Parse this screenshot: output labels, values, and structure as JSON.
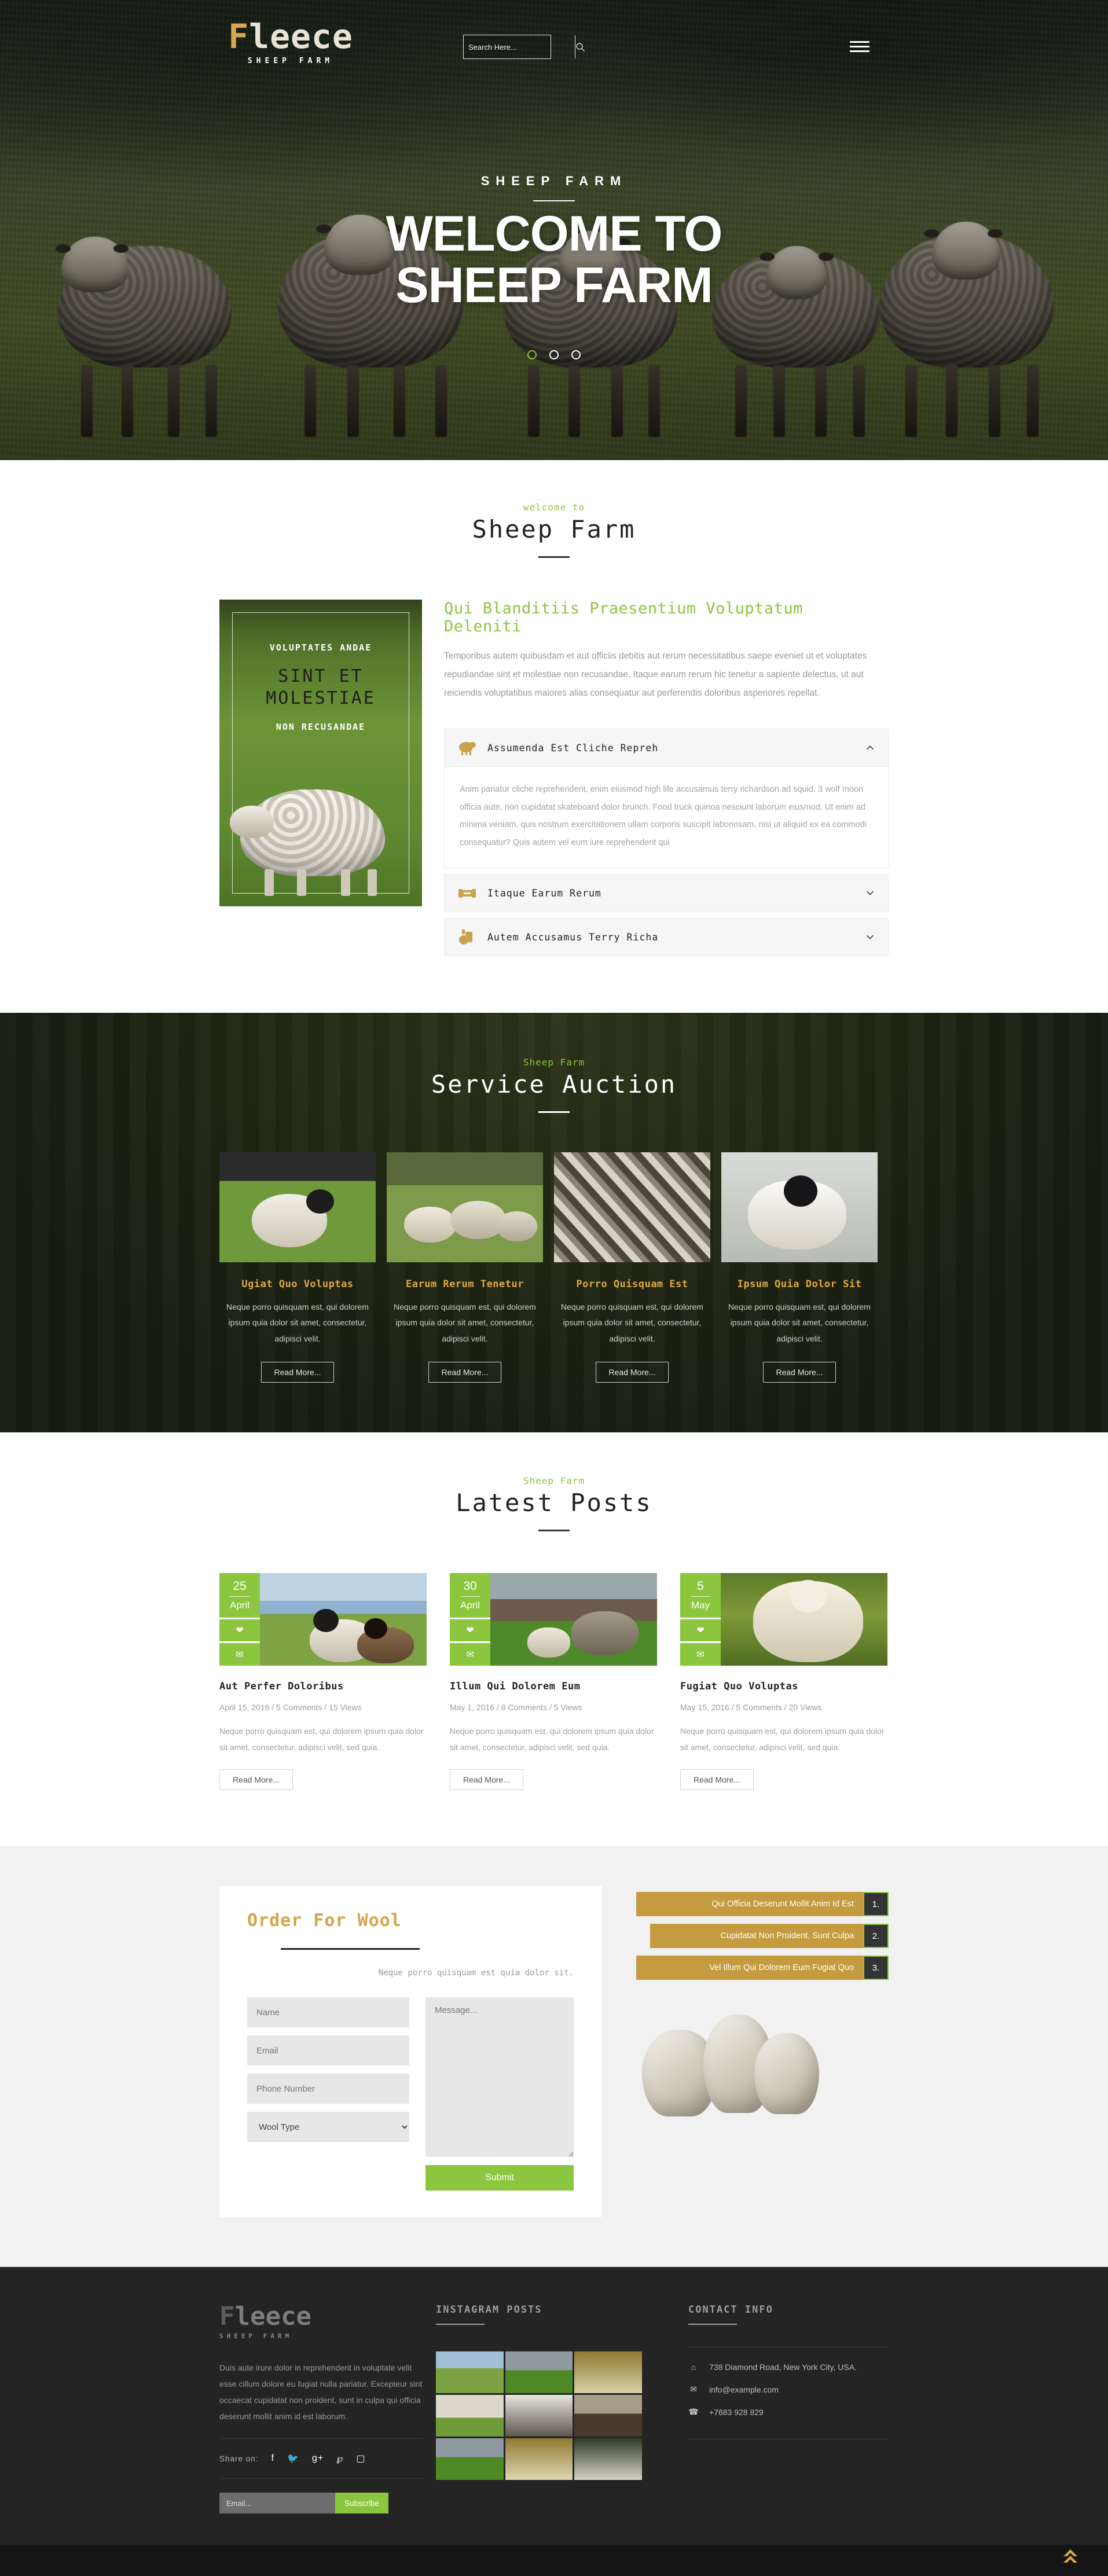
{
  "header": {
    "logo_name_1": "F",
    "logo_name_2": "leece",
    "logo_sub": "SHEEP FARM",
    "search_placeholder": "Search Here...",
    "search_value": "",
    "search_icon": "search-icon",
    "menu_icon": "hamburger-menu-icon"
  },
  "hero": {
    "kicker": "SHEEP FARM",
    "title_line1": "WELCOME TO",
    "title_line2": "SHEEP FARM",
    "dots": [
      "1",
      "2",
      "3"
    ],
    "active_dot": 0
  },
  "about": {
    "kicker": "welcome to",
    "title": "Sheep Farm",
    "image_caption_top": "VOLUPTATES ANDAE",
    "image_caption_main_1": "SINT ET",
    "image_caption_main_2": "MOLESTIAE",
    "image_caption_bottom": "NON RECUSANDAE",
    "heading": "Qui Blanditiis Praesentium Voluptatum Deleniti",
    "paragraph": "Temporibus autem quibusdam et aut officiis debitis aut rerum necessitatibus saepe eveniet ut et voluptates repudiandae sint et molestiae non recusandae. Itaque earum rerum hic tenetur a sapiente delectus, ut aut reiciendis voluptatibus maiores alias consequatur aut perferendis doloribus asperiores repellat.",
    "accordion": [
      {
        "icon": "sheep-icon",
        "title": "Assumenda Est Cliche Repreh",
        "state": "expanded",
        "chevron": "chevron-up-icon",
        "body": "Anim pariatur cliche reprehenderit, enim eiusmod high life accusamus terry richardson ad squid. 3 wolf moon officia aute, non cupidatat skateboard dolor brunch. Food truck quinoa nesciunt laborum eiusmod. Ut enim ad minima veniam, quis nostrum exercitationem ullam corporis suscipit laboriosam, nisi ut aliquid ex ea commodi consequatur? Quis autem vel eum iure reprehenderit qui"
      },
      {
        "icon": "hay-bale-icon",
        "title": "Itaque Earum Rerum",
        "state": "collapsed",
        "chevron": "chevron-down-icon",
        "body": ""
      },
      {
        "icon": "wool-basket-icon",
        "title": "Autem Accusamus Terry Richa",
        "state": "collapsed",
        "chevron": "chevron-down-icon",
        "body": ""
      }
    ]
  },
  "auction": {
    "kicker": "Sheep Farm",
    "title": "Service Auction",
    "cards": [
      {
        "title": "Ugiat Quo Voluptas",
        "text": "Neque porro quisquam est, qui dolorem ipsum quia dolor sit amet, consectetur, adipisci velit.",
        "button": "Read More..."
      },
      {
        "title": "Earum Rerum Tenetur",
        "text": "Neque porro quisquam est, qui dolorem ipsum quia dolor sit amet, consectetur, adipisci velit.",
        "button": "Read More..."
      },
      {
        "title": "Porro Quisquam Est",
        "text": "Neque porro quisquam est, qui dolorem ipsum quia dolor sit amet, consectetur, adipisci velit.",
        "button": "Read More..."
      },
      {
        "title": "Ipsum Quia Dolor Sit",
        "text": "Neque porro quisquam est, qui dolorem ipsum quia dolor sit amet, consectetur, adipisci velit.",
        "button": "Read More..."
      }
    ]
  },
  "posts": {
    "kicker": "Sheep Farm",
    "title": "Latest Posts",
    "items": [
      {
        "day": "25",
        "month": "April",
        "like_icon": "heart-icon",
        "mail_icon": "envelope-icon",
        "title": "Aut Perfer Doloribus",
        "meta": "April 15, 2016  /  5 Comments  /  15 Views",
        "excerpt": "Neque porro quisquam est, qui dolorem ipsum quia dolor sit amet, consectetur, adipisci velit, sed quia.",
        "button": "Read More..."
      },
      {
        "day": "30",
        "month": "April",
        "like_icon": "heart-icon",
        "mail_icon": "envelope-icon",
        "title": "Illum Qui Dolorem Eum",
        "meta": "May 1, 2016  /  8 Comments  /  5 Views",
        "excerpt": "Neque porro quisquam est, qui dolorem ipsum quia dolor sit amet, consectetur, adipisci velit, sed quia.",
        "button": "Read More..."
      },
      {
        "day": "5",
        "month": "May",
        "like_icon": "heart-icon",
        "mail_icon": "envelope-icon",
        "title": "Fugiat Quo Voluptas",
        "meta": "May 15, 2016  /  5 Comments  /  20 Views",
        "excerpt": "Neque porro quisquam est, qui dolorem ipsum quia dolor sit amet, consectetur, adipisci velit, sed quia.",
        "button": "Read More..."
      }
    ]
  },
  "order": {
    "title_1": "Order For ",
    "title_2": "Wool",
    "subtitle": "Neque porro quisquam est quia dolor sit.",
    "fields": {
      "name_placeholder": "Name",
      "email_placeholder": "Email",
      "phone_placeholder": "Phone Number",
      "wool_type_selected": "Wool Type",
      "wool_type_chevron": "chevron-down-icon",
      "message_placeholder": "Message...",
      "submit_label": "Submit"
    },
    "pills": [
      {
        "text": "Qui Officia Deserunt Mollit Anim Id Est",
        "num": "1."
      },
      {
        "text": "Cupidatat Non Proident, Sunt Culpa",
        "num": "2."
      },
      {
        "text": "Vel Illum Qui Dolorem Eum Fugiat Quo",
        "num": "3."
      }
    ]
  },
  "footer": {
    "logo_name_1": "F",
    "logo_name_2": "leece",
    "logo_sub": "SHEEP FARM",
    "about": "Duis aute irure dolor in reprehenderit in voluptate velit esse cillum dolore eu fugiat nulla pariatur. Excepteur sint occaecat cupidatat non proident, sunt in culpa qui officia deserunt mollit anim id est laborum.",
    "share_label": "Share on:",
    "social": [
      "facebook-icon",
      "twitter-icon",
      "google-plus-icon",
      "pinterest-icon",
      "instagram-icon"
    ],
    "social_glyphs": [
      "f",
      "🐦",
      "g+",
      "𝑷",
      "▣"
    ],
    "subscribe_placeholder": "Email...",
    "subscribe_value": "",
    "subscribe_label": "Subscribe",
    "instagram_heading": "INSTAGRAM POSTS",
    "contact_heading": "CONTACT INFO",
    "contact": [
      {
        "icon": "home-icon",
        "glyph": "⌂",
        "text": "738 Diamond Road, New York City, USA."
      },
      {
        "icon": "envelope-icon",
        "glyph": "✉",
        "text": "info@example.com"
      },
      {
        "icon": "phone-icon",
        "glyph": "☎",
        "text": "+7683 928 829"
      }
    ],
    "back_to_top_icon": "double-chevron-up-icon"
  },
  "colors": {
    "accent_green": "#8cc63e",
    "accent_gold": "#d7a94f",
    "pill_gold": "#c49b3e",
    "dark": "#242424"
  }
}
